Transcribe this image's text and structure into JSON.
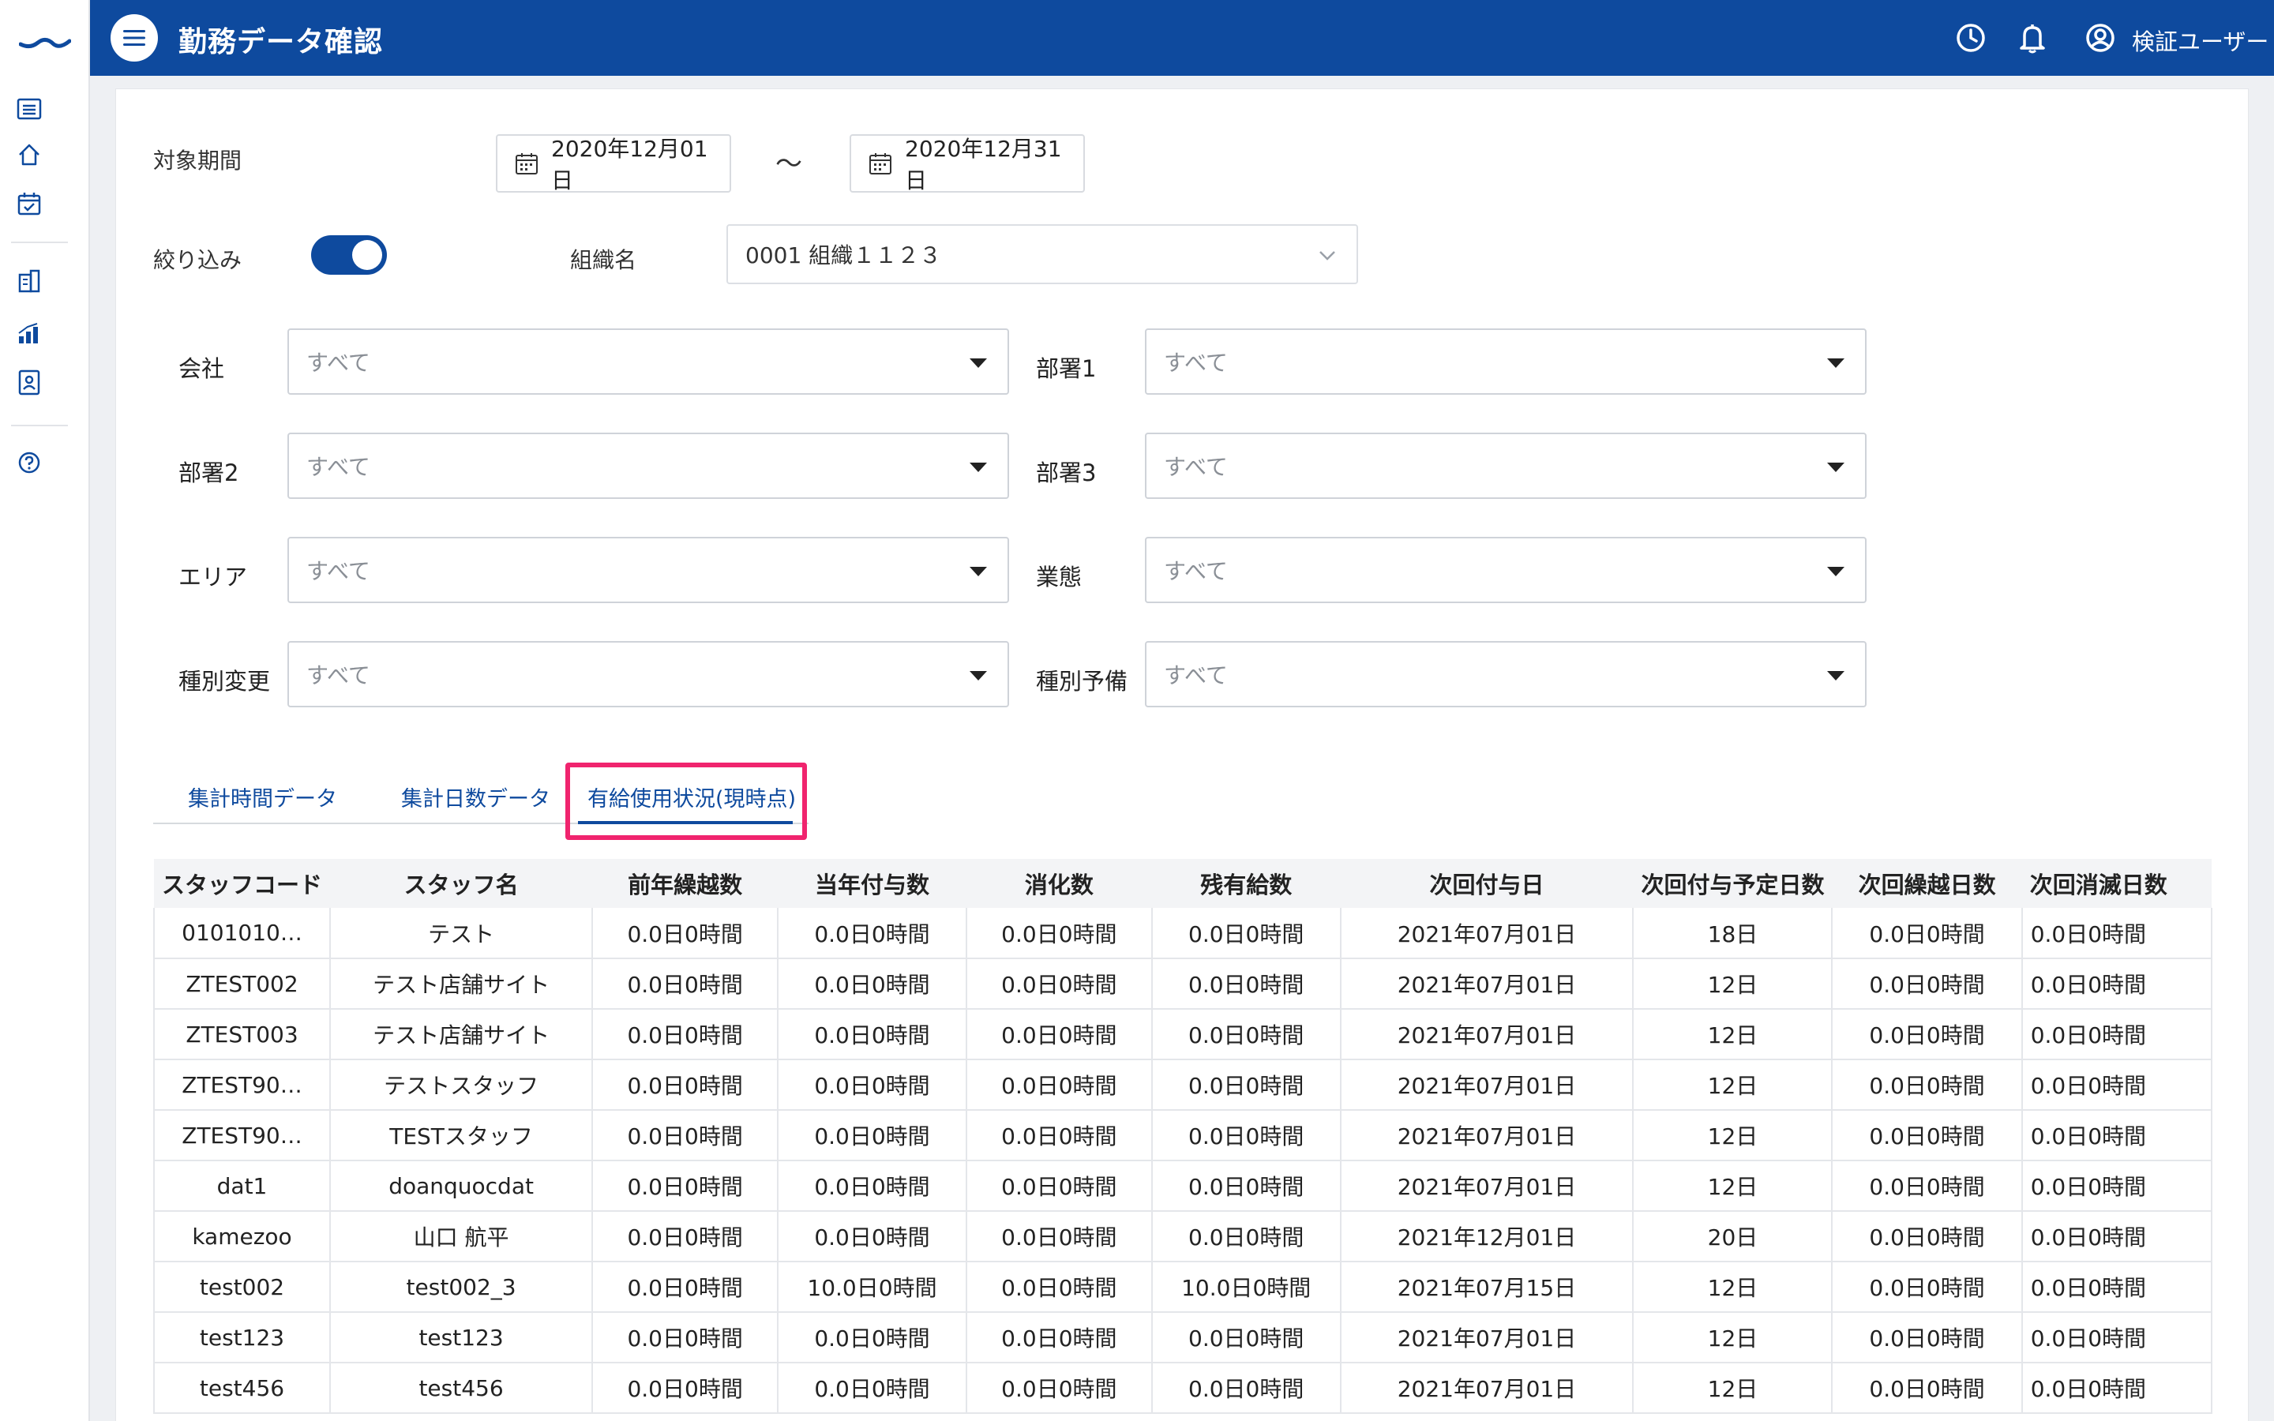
{
  "header": {
    "title": "勤務データ確認",
    "user_name": "検証ユーザー"
  },
  "filters": {
    "period_label": "対象期間",
    "date_from": "2020年12月01日",
    "tilde": "〜",
    "date_to": "2020年12月31日",
    "narrow_label": "絞り込み",
    "narrow_enabled": true,
    "org_label": "組織名",
    "org_value": "0001 組織１１２３",
    "fields": [
      {
        "label": "会社",
        "value": "すべて"
      },
      {
        "label": "部署1",
        "value": "すべて"
      },
      {
        "label": "部署2",
        "value": "すべて"
      },
      {
        "label": "部署3",
        "value": "すべて"
      },
      {
        "label": "エリア",
        "value": "すべて"
      },
      {
        "label": "業態",
        "value": "すべて"
      },
      {
        "label": "種別変更",
        "value": "すべて"
      },
      {
        "label": "種別予備",
        "value": "すべて"
      }
    ]
  },
  "tabs": [
    {
      "label": "集計時間データ"
    },
    {
      "label": "集計日数データ"
    },
    {
      "label": "有給使用状況(現時点)",
      "active": true
    }
  ],
  "table": {
    "columns": [
      "スタッフコード",
      "スタッフ名",
      "前年繰越数",
      "当年付与数",
      "消化数",
      "残有給数",
      "次回付与日",
      "次回付与予定日数",
      "次回繰越日数",
      "次回消滅日数"
    ],
    "rows": [
      [
        "0101010…",
        "テスト",
        "0.0日0時間",
        "0.0日0時間",
        "0.0日0時間",
        "0.0日0時間",
        "2021年07月01日",
        "18日",
        "0.0日0時間",
        "0.0日0時間"
      ],
      [
        "ZTEST002",
        "テスト店舗サイト",
        "0.0日0時間",
        "0.0日0時間",
        "0.0日0時間",
        "0.0日0時間",
        "2021年07月01日",
        "12日",
        "0.0日0時間",
        "0.0日0時間"
      ],
      [
        "ZTEST003",
        "テスト店舗サイト",
        "0.0日0時間",
        "0.0日0時間",
        "0.0日0時間",
        "0.0日0時間",
        "2021年07月01日",
        "12日",
        "0.0日0時間",
        "0.0日0時間"
      ],
      [
        "ZTEST90…",
        "テストスタッフ",
        "0.0日0時間",
        "0.0日0時間",
        "0.0日0時間",
        "0.0日0時間",
        "2021年07月01日",
        "12日",
        "0.0日0時間",
        "0.0日0時間"
      ],
      [
        "ZTEST90…",
        "TESTスタッフ",
        "0.0日0時間",
        "0.0日0時間",
        "0.0日0時間",
        "0.0日0時間",
        "2021年07月01日",
        "12日",
        "0.0日0時間",
        "0.0日0時間"
      ],
      [
        "dat1",
        "doanquocdat",
        "0.0日0時間",
        "0.0日0時間",
        "0.0日0時間",
        "0.0日0時間",
        "2021年07月01日",
        "12日",
        "0.0日0時間",
        "0.0日0時間"
      ],
      [
        "kamezoo",
        "山口 航平",
        "0.0日0時間",
        "0.0日0時間",
        "0.0日0時間",
        "0.0日0時間",
        "2021年12月01日",
        "20日",
        "0.0日0時間",
        "0.0日0時間"
      ],
      [
        "test002",
        "test002_3",
        "0.0日0時間",
        "10.0日0時間",
        "0.0日0時間",
        "10.0日0時間",
        "2021年07月15日",
        "12日",
        "0.0日0時間",
        "0.0日0時間"
      ],
      [
        "test123",
        "test123",
        "0.0日0時間",
        "0.0日0時間",
        "0.0日0時間",
        "0.0日0時間",
        "2021年07月01日",
        "12日",
        "0.0日0時間",
        "0.0日0時間"
      ],
      [
        "test456",
        "test456",
        "0.0日0時間",
        "0.0日0時間",
        "0.0日0時間",
        "0.0日0時間",
        "2021年07月01日",
        "12日",
        "0.0日0時間",
        "0.0日0時間"
      ]
    ]
  },
  "colors": {
    "primary": "#0e4a9e",
    "highlight": "#f0246e"
  }
}
